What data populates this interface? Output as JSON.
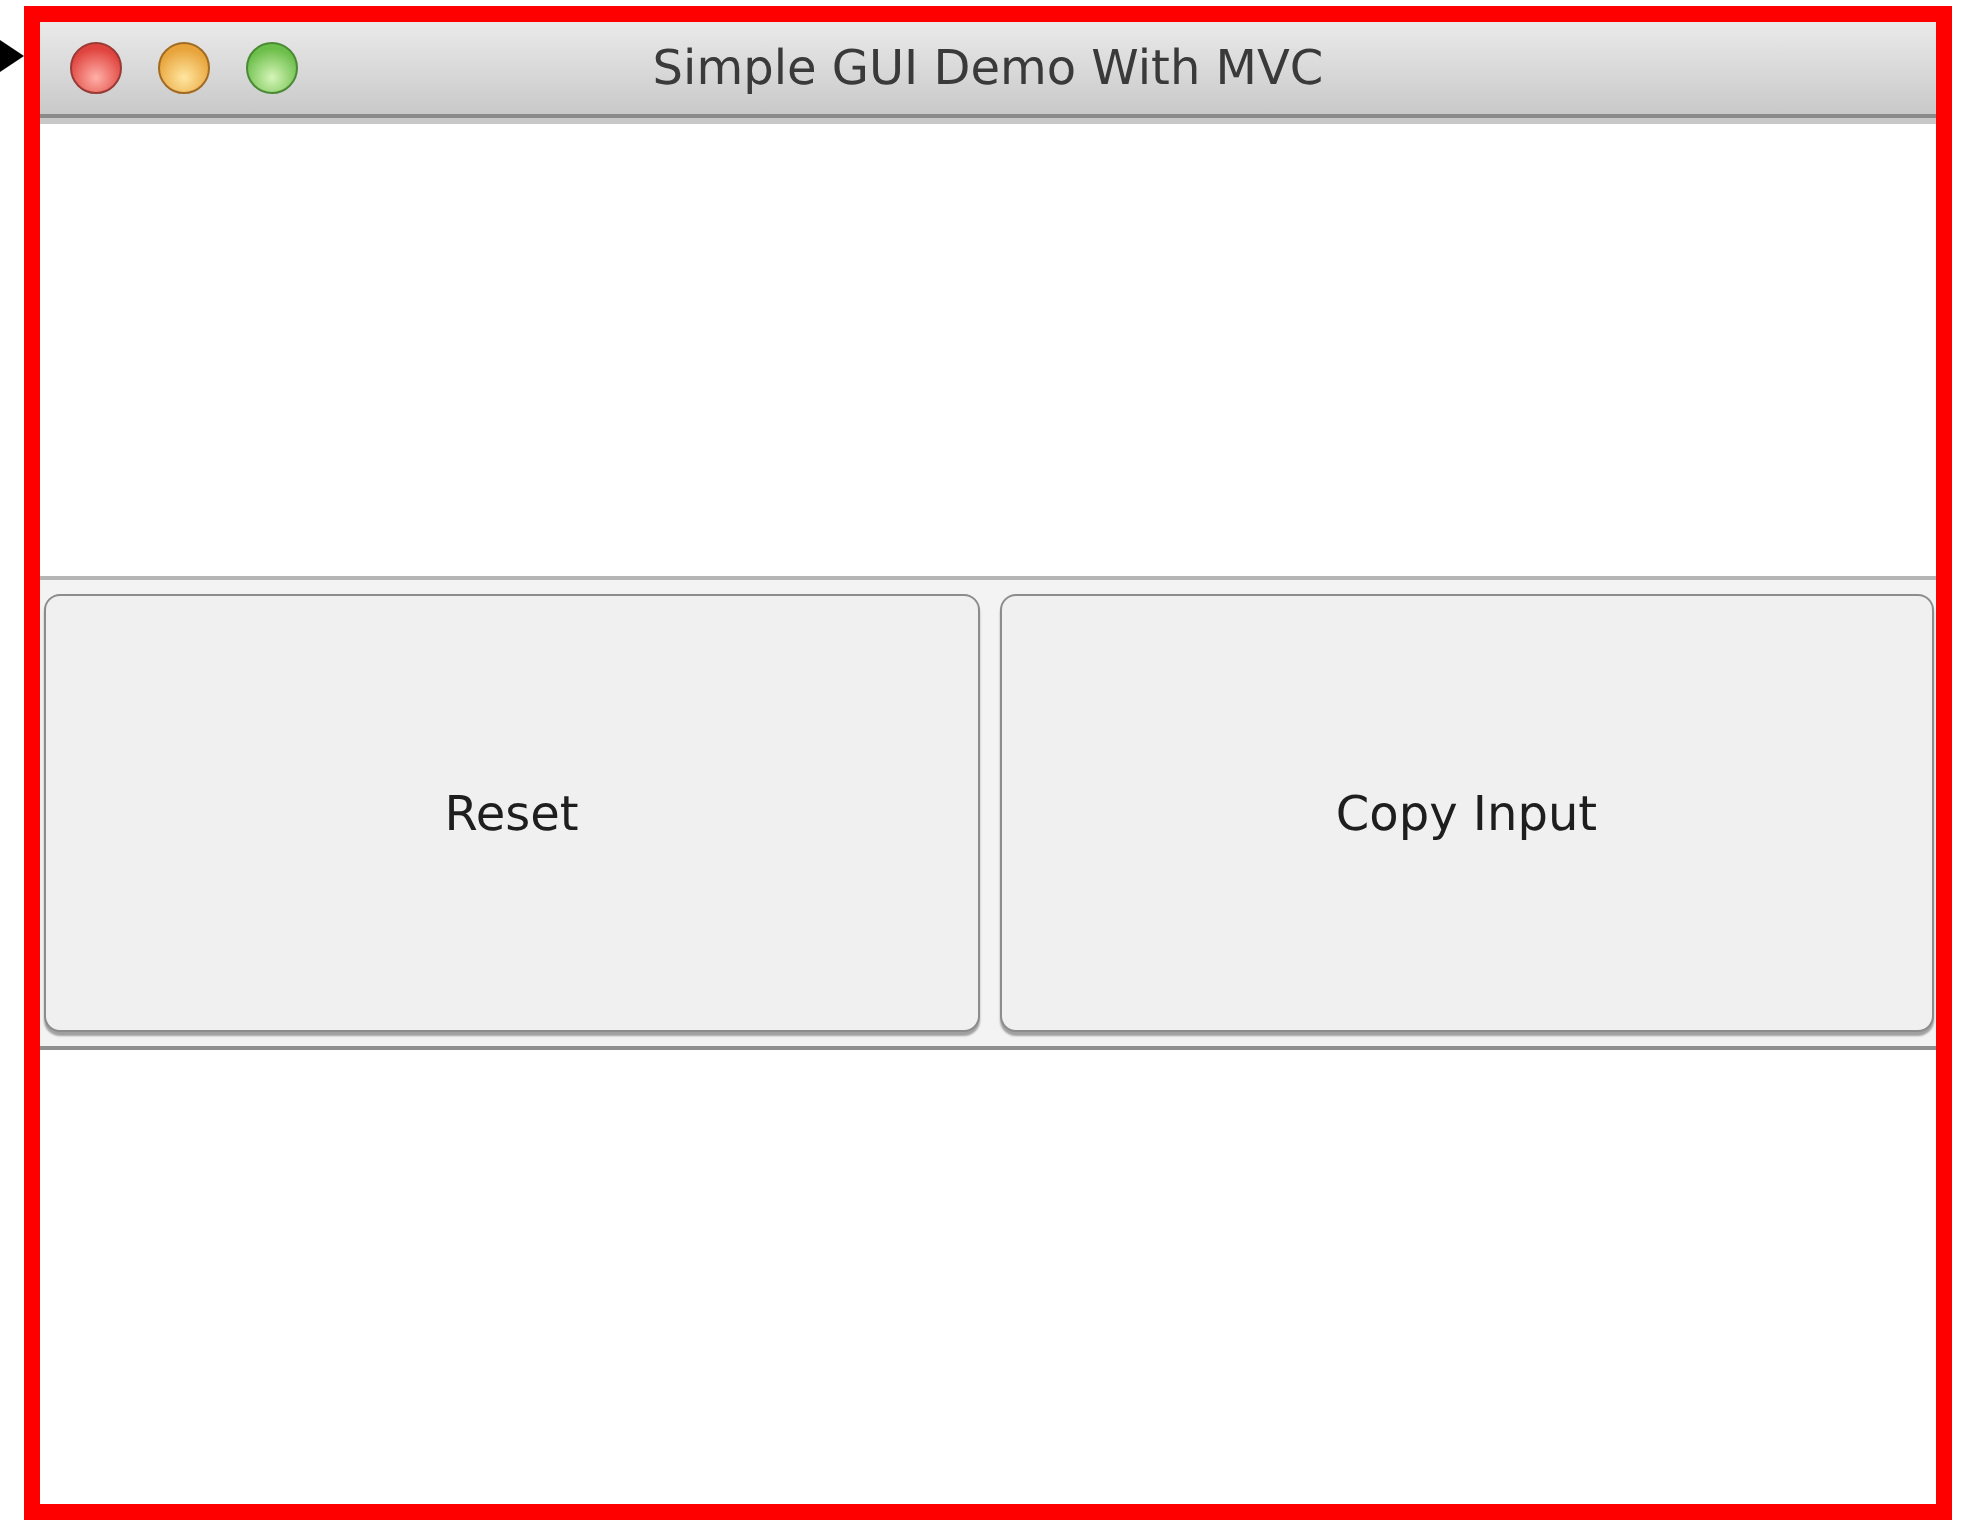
{
  "window": {
    "title": "Simple GUI Demo With MVC"
  },
  "buttons": [
    {
      "label": "Reset"
    },
    {
      "label": "Copy Input"
    }
  ]
}
